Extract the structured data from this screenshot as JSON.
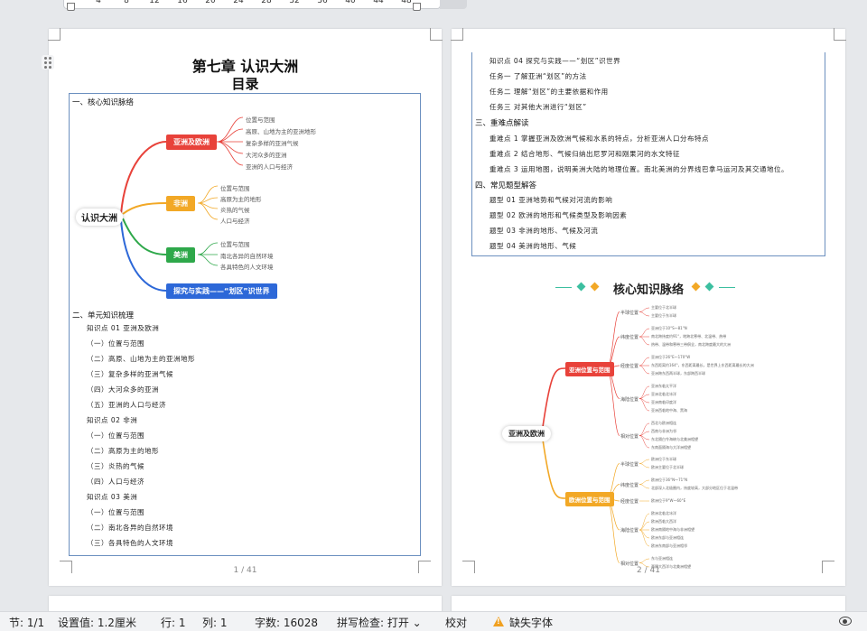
{
  "ruler": {
    "ticks": [
      "4",
      "8",
      "12",
      "16",
      "20",
      "24",
      "28",
      "32",
      "36",
      "40",
      "44",
      "48"
    ]
  },
  "page1": {
    "chapter_title": "第七章   认识大洲",
    "toc_title": "目录",
    "section1": "一、核心知识脉络",
    "mindmap": {
      "center": "认识大洲",
      "branches": [
        {
          "label": "亚洲及欧洲",
          "color": "#e8423a",
          "leaves": [
            "位置与范围",
            "高原、山地为主的亚洲地形",
            "复杂多样的亚洲气候",
            "大河众多的亚洲",
            "亚洲的人口与经济"
          ]
        },
        {
          "label": "非洲",
          "color": "#f2a826",
          "leaves": [
            "位置与范围",
            "高原为主的地形",
            "炎热的气候",
            "人口与经济"
          ]
        },
        {
          "label": "美洲",
          "color": "#2ea84a",
          "leaves": [
            "位置与范围",
            "南北各异的自然环境",
            "各具特色的人文环境"
          ]
        },
        {
          "label": "探究与实践——“划区”识世界",
          "color": "#2d68d8",
          "leaves": []
        }
      ]
    },
    "section2": "二、单元知识梳理",
    "outline": [
      "知识点 01  亚洲及欧洲",
      "（一）位置与范围",
      "（二）高原、山地为主的亚洲地形",
      "（三）复杂多样的亚洲气候",
      "（四）大河众多的亚洲",
      "（五）亚洲的人口与经济",
      "知识点 02  非洲",
      "（一）位置与范围",
      "（二）高原为主的地形",
      "（三）炎热的气候",
      "（四）人口与经济",
      "知识点 03  美洲",
      "（一）位置与范围",
      "（二）南北各异的自然环境",
      "（三）各具特色的人文环境"
    ],
    "page_number": "1 / 41"
  },
  "page2": {
    "lines_top": [
      "知识点 04  探究与实践——“划区”识世界",
      "任务一  了解亚洲“划区”的方法",
      "任务二  理解“划区”的主要依据和作用",
      "任务三  对其他大洲进行“划区”"
    ],
    "section3": "三、重难点解读",
    "key_points": [
      "重难点 1  掌握亚洲及欧洲气候和水系的特点，分析亚洲人口分布特点",
      "重难点 2  结合地形、气候归纳出尼罗河和刚果河的水文特征",
      "重难点 3  运用地图，说明美洲大陆的地理位置。南北美洲的分界线巴拿马运河及其交通地位。"
    ],
    "section4": "四、常见题型解答",
    "question_types": [
      "题型 01  亚洲地势和气候对河流的影响",
      "题型 02  欧洲的地形和气候类型及影响因素",
      "题型 03  非洲的地形、气候及河流",
      "题型 04  美洲的地形、气候"
    ],
    "banner_title": "核心知识脉络",
    "mindmap2": {
      "center": "亚洲及欧洲",
      "branches": [
        {
          "label": "亚洲位置与范围",
          "color": "#e8423a",
          "subs": [
            {
              "label": "半球位置",
              "leaves": [
                "主要位于北半球",
                "主要位于东半球"
              ]
            },
            {
              "label": "纬度位置",
              "leaves": [
                "亚洲位于10°S～81°N",
                "南北跨纬度约91°，地跨北寒带、北温带、热带",
                "热带、温带和寒带三带俱全，南北跨度最大的大洲"
              ]
            },
            {
              "label": "经度位置",
              "leaves": [
                "亚洲位于26°E～170°W",
                "东西距离约164°，东西距离最长，是世界上东西距离最长的大洲",
                "亚洲跨东西两半球，东部跨西半球"
              ]
            },
            {
              "label": "海陆位置",
              "leaves": [
                "亚洲东临太平洋",
                "亚洲北临北冰洋",
                "亚洲南临印度洋",
                "亚洲西临地中海、黑海"
              ]
            },
            {
              "label": "相对位置",
              "leaves": [
                "西北与欧洲相连",
                "西南与非洲为邻",
                "东北隔白令海峡与北美洲相望",
                "东南面隔海与大洋洲相望"
              ]
            }
          ]
        },
        {
          "label": "欧洲位置与范围",
          "color": "#f2a826",
          "subs": [
            {
              "label": "半球位置",
              "leaves": [
                "欧洲位于东半球",
                "欧洲主要位于北半球"
              ]
            },
            {
              "label": "纬度位置",
              "leaves": [
                "欧洲位于36°N～71°N",
                "北部深入北极圈内，纬度较高，大部分地区位于北温带"
              ]
            },
            {
              "label": "经度位置",
              "leaves": [
                "欧洲位于9°W～60°E"
              ]
            },
            {
              "label": "海陆位置",
              "leaves": [
                "欧洲北临北冰洋",
                "欧洲西临大西洋",
                "欧洲南隔地中海与非洲相望",
                "欧洲东部与亚洲相连",
                "欧洲东南部与亚洲相邻"
              ]
            },
            {
              "label": "相对位置",
              "leaves": [
                "东与亚洲相连",
                "西隔大西洋与北美洲相望"
              ]
            }
          ]
        }
      ]
    },
    "page_number": "2 / 41"
  },
  "status_bar": {
    "section": "节: 1/1",
    "setting": "设置值: 1.2厘米",
    "row": "行: 1",
    "col": "列: 1",
    "word_count": "字数: 16028",
    "spell_check": "拼写检查: 打开 ⌄",
    "proofread": "校对",
    "missing_font": "缺失字体"
  },
  "colors": {
    "red": "#e8423a",
    "orange": "#f2a826",
    "green": "#2ea84a",
    "blue": "#2d68d8",
    "teal": "#3cbfa0"
  }
}
